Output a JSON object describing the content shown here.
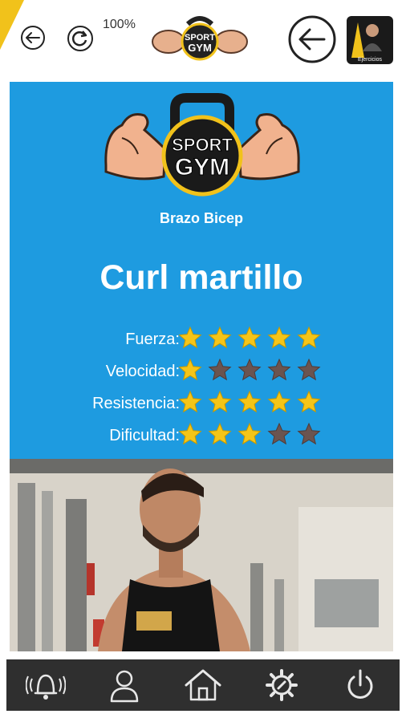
{
  "status": {
    "zoom_level": "100%"
  },
  "header": {
    "logo_line1": "SPORT",
    "logo_line2": "GYM",
    "thumb_caption": "Ejercicios"
  },
  "card": {
    "category": "Brazo Bicep",
    "title": "Curl martillo",
    "ratings": [
      {
        "label": "Fuerza:",
        "filled": 5,
        "total": 5
      },
      {
        "label": "Velocidad:",
        "filled": 1,
        "total": 5
      },
      {
        "label": "Resistencia:",
        "filled": 5,
        "total": 5
      },
      {
        "label": "Dificultad:",
        "filled": 3,
        "total": 5
      }
    ]
  },
  "nav": {
    "items": [
      {
        "name": "notifications",
        "icon": "bell-icon"
      },
      {
        "name": "profile",
        "icon": "user-icon"
      },
      {
        "name": "home",
        "icon": "home-icon"
      },
      {
        "name": "settings",
        "icon": "gear-wrench-icon"
      },
      {
        "name": "power",
        "icon": "power-icon"
      }
    ]
  },
  "colors": {
    "card_bg": "#1e9be0",
    "star_on": "#f5c518",
    "star_off": "#6b5450",
    "nav_bg": "#2f2f2f",
    "corner": "#f1c21b"
  }
}
